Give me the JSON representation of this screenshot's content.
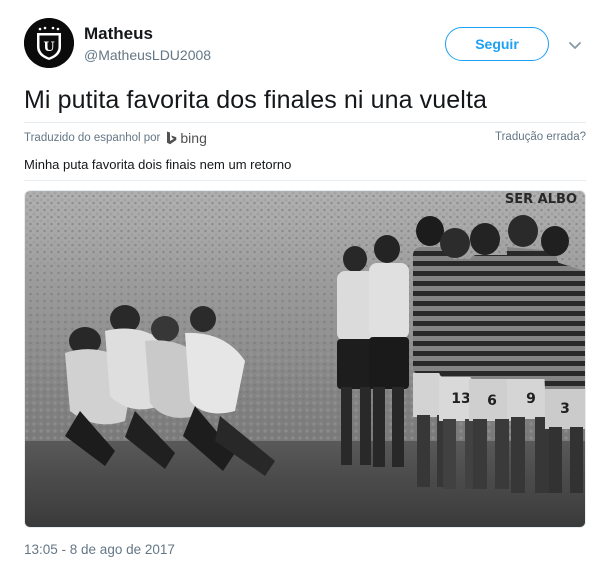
{
  "user": {
    "name": "Matheus",
    "handle": "@MatheusLDU2008",
    "avatar_icon": "ldu-crest-icon"
  },
  "actions": {
    "follow_label": "Seguir",
    "more_icon": "chevron-down-icon"
  },
  "tweet": {
    "text": "Mi putita favorita dos finales ni una vuelta",
    "translated_by_label": "Traduzido do espanhol por",
    "translator_name": "bing",
    "wrong_translation_label": "Tradução errada?",
    "translation_text": "Minha puta favorita dois finais nem um retorno",
    "media_watermark": "SER ALBO",
    "jersey_numbers": [
      "13",
      "6",
      "9",
      "3"
    ],
    "timestamp": "13:05 - 8 de ago de 2017"
  },
  "colors": {
    "accent": "#1da1f2",
    "text_primary": "#14171a",
    "text_secondary": "#657786",
    "divider": "#e6ecf0"
  }
}
